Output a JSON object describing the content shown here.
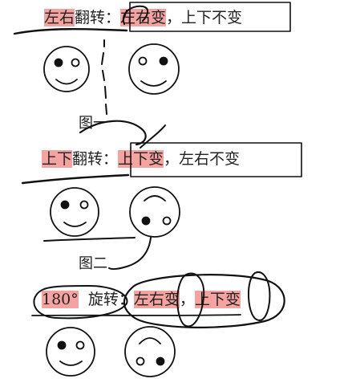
{
  "section1": {
    "label_hl": "左右",
    "label_rest": "翻转：",
    "change_hl": "左右变",
    "rest": "，上下不变"
  },
  "figure1": "图一",
  "section2": {
    "label_hl": "上下",
    "label_rest": "翻转：",
    "change_hl": "上下变",
    "rest": "，左右不变"
  },
  "figure2": "图二",
  "section3": {
    "label_hl": "180°",
    "label_rest": "旋转：",
    "change1_hl": "左右变",
    "sep": "，",
    "change2_hl": "上下变"
  },
  "colors": {
    "highlight": "#f5a3a0",
    "ink": "#111111"
  }
}
